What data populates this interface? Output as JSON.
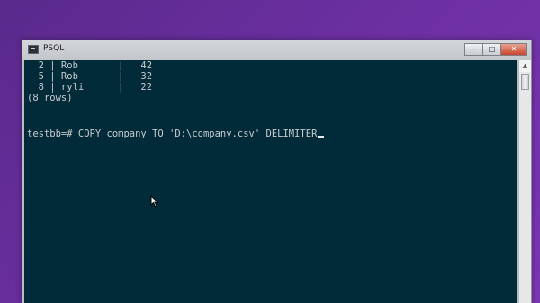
{
  "window": {
    "title": "PSQL",
    "icon": "terminal-icon",
    "controls": {
      "minimize": "–",
      "maximize": "□",
      "close": "✕"
    }
  },
  "terminal": {
    "lines": [
      "  2 | Rob       |   42",
      "  5 | Rob       |   32",
      "  8 | ryli      |   22",
      "(8 rows)",
      "",
      "",
      "testbb=# COPY company TO 'D:\\company.csv' DELIMITER"
    ]
  },
  "scrollbar": {
    "up_arrow": "▲"
  },
  "colors": {
    "desktop": "#6b2fa0",
    "terminal_bg": "#012b38",
    "terminal_text": "#c9ccd0"
  }
}
